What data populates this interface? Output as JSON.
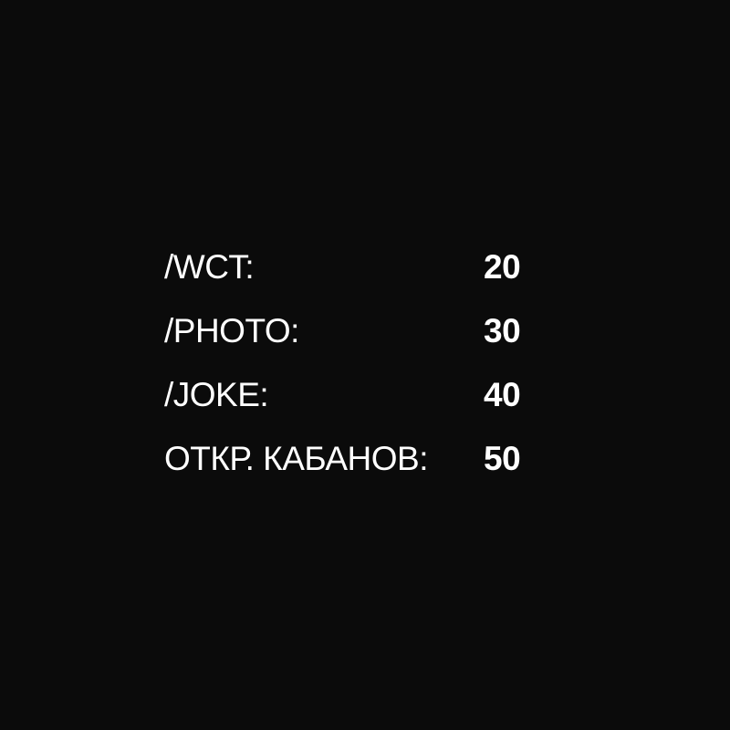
{
  "price_list": {
    "rows": [
      {
        "label": "/WCT:",
        "value": "20"
      },
      {
        "label": "/PHOTO:",
        "value": "30"
      },
      {
        "label": "/JOKE:",
        "value": "40"
      },
      {
        "label": "ОТКР. КАБАНОВ:",
        "value": "50"
      }
    ]
  },
  "colors": {
    "background": "#0b0b0b",
    "text": "#ffffff"
  }
}
